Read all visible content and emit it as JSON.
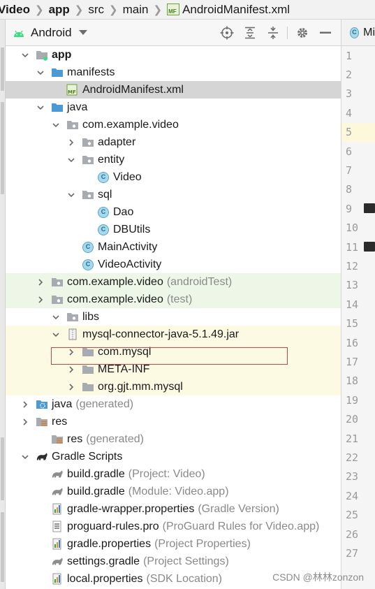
{
  "breadcrumb": {
    "items": [
      "Video",
      "app",
      "src",
      "main"
    ],
    "file_badge": "MF",
    "file": "AndroidManifest.xml"
  },
  "panel": {
    "view_label": "Android"
  },
  "tree": [
    {
      "label": "app",
      "bold": true,
      "suffix": "",
      "icon": "app-module-icon",
      "arrow": "open"
    },
    {
      "label": "manifests",
      "suffix": "",
      "icon": "folder-icon",
      "arrow": "open"
    },
    {
      "label": "AndroidManifest.xml",
      "suffix": "",
      "icon": "manifest-file-icon",
      "arrow": "none",
      "selected": true
    },
    {
      "label": "java",
      "suffix": "",
      "icon": "folder-icon",
      "arrow": "open"
    },
    {
      "label": "com.example.video",
      "suffix": "",
      "icon": "package-icon",
      "arrow": "open"
    },
    {
      "label": "adapter",
      "suffix": "",
      "icon": "package-icon",
      "arrow": "closed"
    },
    {
      "label": "entity",
      "suffix": "",
      "icon": "package-icon",
      "arrow": "open"
    },
    {
      "label": "Video",
      "suffix": "",
      "icon": "class-icon",
      "arrow": "none"
    },
    {
      "label": "sql",
      "suffix": "",
      "icon": "package-icon",
      "arrow": "open"
    },
    {
      "label": "Dao",
      "suffix": "",
      "icon": "class-icon",
      "arrow": "none"
    },
    {
      "label": "DBUtils",
      "suffix": "",
      "icon": "class-icon",
      "arrow": "none"
    },
    {
      "label": "MainActivity",
      "suffix": "",
      "icon": "class-icon",
      "arrow": "none"
    },
    {
      "label": "VideoActivity",
      "suffix": "",
      "icon": "class-icon",
      "arrow": "none"
    },
    {
      "label": "com.example.video",
      "suffix": "(androidTest)",
      "icon": "package-icon",
      "arrow": "closed",
      "bg": "test"
    },
    {
      "label": "com.example.video",
      "suffix": "(test)",
      "icon": "package-icon",
      "arrow": "closed",
      "bg": "test"
    },
    {
      "label": "libs",
      "suffix": "",
      "icon": "package-icon",
      "arrow": "open"
    },
    {
      "label": "mysql-connector-java-5.1.49.jar",
      "suffix": "",
      "icon": "jar-icon",
      "arrow": "open",
      "bg": "lib"
    },
    {
      "label": "com.mysql",
      "suffix": "",
      "icon": "folder-gray-icon",
      "arrow": "closed",
      "bg": "lib"
    },
    {
      "label": "META-INF",
      "suffix": "",
      "icon": "folder-gray-icon",
      "arrow": "closed",
      "bg": "lib"
    },
    {
      "label": "org.gjt.mm.mysql",
      "suffix": "",
      "icon": "folder-gray-icon",
      "arrow": "closed",
      "bg": "lib"
    },
    {
      "label": "java",
      "suffix": "(generated)",
      "icon": "generated-folder-icon",
      "arrow": "closed"
    },
    {
      "label": "res",
      "suffix": "",
      "icon": "res-folder-icon",
      "arrow": "closed"
    },
    {
      "label": "res",
      "suffix": "(generated)",
      "icon": "res-folder-icon",
      "arrow": "none"
    },
    {
      "label": "Gradle Scripts",
      "suffix": "",
      "icon": "gradle-icon",
      "arrow": "open"
    },
    {
      "label": "build.gradle",
      "suffix": "(Project: Video)",
      "icon": "gradle-file-icon",
      "arrow": "none"
    },
    {
      "label": "build.gradle",
      "suffix": "(Module: Video.app)",
      "icon": "gradle-file-icon",
      "arrow": "none"
    },
    {
      "label": "gradle-wrapper.properties",
      "suffix": "(Gradle Version)",
      "icon": "properties-file-icon",
      "arrow": "none"
    },
    {
      "label": "proguard-rules.pro",
      "suffix": "(ProGuard Rules for Video.app)",
      "icon": "text-file-icon",
      "arrow": "none"
    },
    {
      "label": "gradle.properties",
      "suffix": "(Project Properties)",
      "icon": "properties-file-icon",
      "arrow": "none"
    },
    {
      "label": "settings.gradle",
      "suffix": "(Project Settings)",
      "icon": "gradle-file-icon",
      "arrow": "none"
    },
    {
      "label": "local.properties",
      "suffix": "(SDK Location)",
      "icon": "properties-file-icon",
      "arrow": "none"
    }
  ],
  "editor": {
    "tab_badge": "C",
    "tab_label": "Mi",
    "line_numbers": [
      "1",
      "2",
      "3",
      "4",
      "5",
      "6",
      "7",
      "8",
      "9",
      "10",
      "11",
      "12",
      "13",
      "14",
      "15",
      "16",
      "17",
      "18",
      "19",
      "20",
      "21",
      "22",
      "23",
      "24",
      "25",
      "26",
      "27"
    ],
    "current_line": "5"
  },
  "watermark": "CSDN @林林zonzon",
  "colors": {
    "selection": "#d5d5d5",
    "test_bg": "#eef6e8",
    "lib_bg": "#fdfae3",
    "highlight_box": "#e03a3a",
    "class_icon": "#a8d8ec"
  }
}
